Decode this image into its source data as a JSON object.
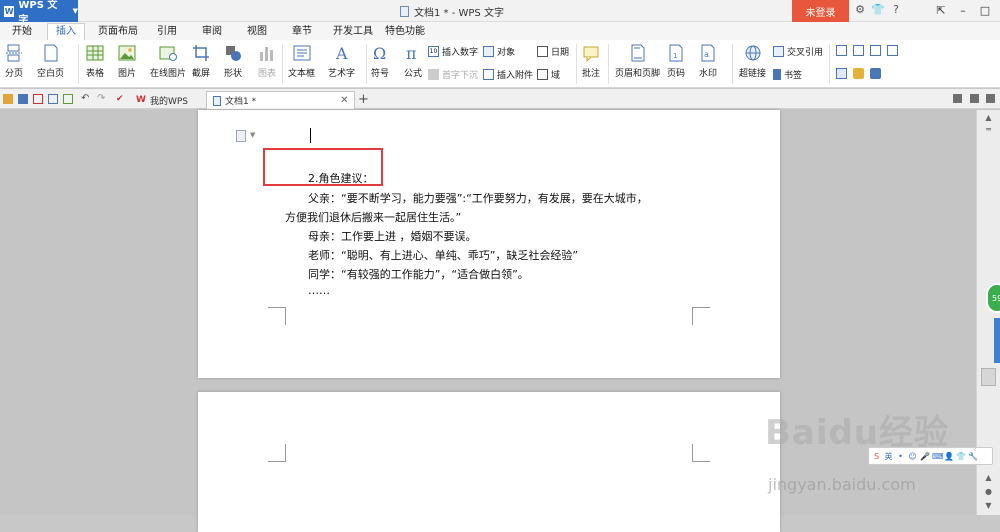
{
  "titlebar": {
    "app_name": "WPS 文字",
    "window_title": "文档1 * - WPS 文字",
    "login_label": "未登录"
  },
  "menu": {
    "tabs": [
      "开始",
      "插入",
      "页面布局",
      "引用",
      "审阅",
      "视图",
      "章节",
      "开发工具",
      "特色功能"
    ],
    "active_tab": "插入"
  },
  "ribbon": {
    "page_break": "分页",
    "blank_page": "空白页",
    "table": "表格",
    "picture": "图片",
    "online_picture": "在线图片",
    "screenshot": "截屏",
    "shape": "形状",
    "chart": "图表",
    "textbox": "文本框",
    "wordart": "艺术字",
    "symbol": "符号",
    "formula": "公式",
    "insert_number": "插入数字",
    "object": "对象",
    "date": "日期",
    "dropcap": "首字下沉",
    "attachment": "插入附件",
    "field": "域",
    "comment": "批注",
    "header_footer": "页眉和页脚",
    "page_number": "页码",
    "watermark": "水印",
    "hyperlink": "超链接",
    "crossref": "交叉引用",
    "bookmark": "书签"
  },
  "doc_tabs": {
    "my_wps": "我的WPS",
    "doc1": "文档1 *"
  },
  "document": {
    "lines": [
      "2.角色建议：",
      "父亲：“要不断学习，能力要强”:“工作要努力，有发展，要在大城市，",
      "方便我们退休后搬来一起居住生活。”",
      "母亲：工作要上进 ，婚姻不要误。",
      "老师：“聪明、有上进心、单纯、乖巧”，缺乏社会经验”",
      "同学：“有较强的工作能力”，“适合做白领”。",
      "……"
    ]
  },
  "side_badge": "59",
  "watermark": {
    "main": "Baidu经验",
    "sub": "jingyan.baidu.com"
  },
  "colors": {
    "accent": "#2f6fc6",
    "login": "#e8573b",
    "highlight_box": "#e23b3b"
  }
}
